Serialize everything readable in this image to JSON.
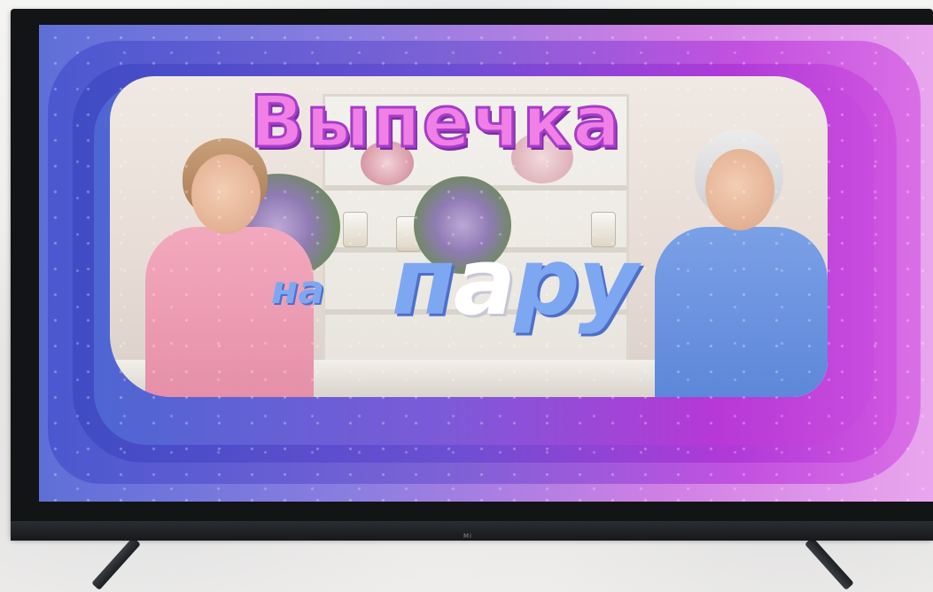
{
  "title_line1": "Выпечка",
  "title_line2_prefix": "на",
  "title_line2_p": "п",
  "title_line2_a": "а",
  "title_line2_ru": "ру",
  "tv_logo": "Mi",
  "colors": {
    "title_pink": "#f07fe6",
    "title_blue": "#7ea7f2",
    "frame_blue": "#4b58cf",
    "frame_purple": "#b139d8",
    "bezel": "#121416"
  }
}
